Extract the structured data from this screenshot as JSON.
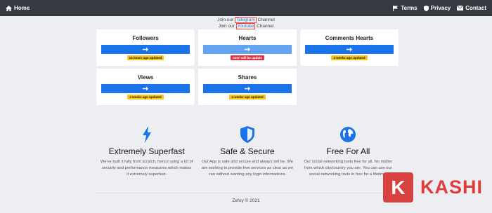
{
  "nav": {
    "home_label": "Home",
    "terms_label": "Terms",
    "privacy_label": "Privacy",
    "contact_label": "Contact"
  },
  "join": {
    "prefix": "Join our",
    "telegram": "Telegram",
    "channel": "Channel",
    "youtube": "Youtube"
  },
  "cards": [
    {
      "title": "Followers",
      "badge": "13 hours ago updated",
      "badge_color": "#f5c518"
    },
    {
      "title": "Hearts",
      "badge": "soon will be update",
      "badge_color": "#dc3545"
    },
    {
      "title": "Comments Hearts",
      "badge": "4 weeks ago updated",
      "badge_color": "#f5c518"
    },
    {
      "title": "Views",
      "badge": "4 weeks ago updated",
      "badge_color": "#f5c518"
    },
    {
      "title": "Shares",
      "badge": "4 weeks ago updated",
      "badge_color": "#f5c518"
    }
  ],
  "features": [
    {
      "title": "Extremely Superfast",
      "text": "We've built it fully from scratch, hence using a lot of security and performance measures which makes it extremely superfast.",
      "icon": "bolt-icon"
    },
    {
      "title": "Safe & Secure",
      "text": "Our App is safe and secure and always will be. We are working to provide free services as clear as we can without wanting any login informations.",
      "icon": "shield-icon"
    },
    {
      "title": "Free For All",
      "text": "Our social networking tools free for all. No matter from which city/country you are. You can use our social networking tools in free for a lifetime.",
      "icon": "globe-icon"
    }
  ],
  "footer": "Zefoy © 2021",
  "watermark": {
    "letter": "K",
    "text": "KASHI"
  },
  "colors": {
    "accent": "#1a73e8",
    "navbar": "#343a40",
    "watermark": "#e03c3c"
  }
}
